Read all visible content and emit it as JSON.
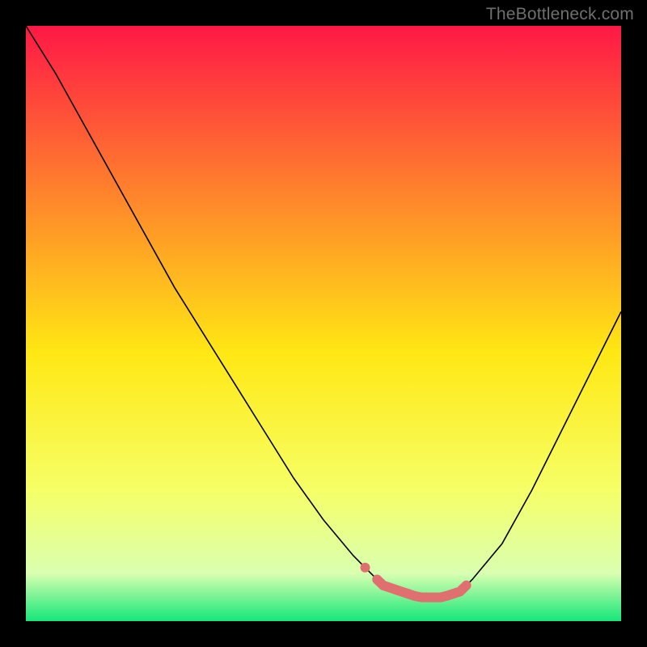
{
  "watermark": "TheBottleneck.com",
  "gradient": {
    "top": "#ff1846",
    "upper_mid": "#ff8a2a",
    "mid": "#ffe814",
    "lower_mid": "#f6ff67",
    "near_bottom": "#d9ffb0",
    "bottom": "#14e77a"
  },
  "curve": {
    "stroke": "#000000",
    "stroke_width": 1.6
  },
  "highlight": {
    "fill": "#e07070",
    "stroke": "#e07070"
  },
  "chart_data": {
    "type": "line",
    "title": "",
    "xlabel": "",
    "ylabel": "",
    "xlim": [
      0,
      100
    ],
    "ylim": [
      0,
      100
    ],
    "grid": false,
    "legend": false,
    "series": [
      {
        "name": "bottleneck-curve",
        "x": [
          0,
          5,
          10,
          15,
          20,
          25,
          30,
          35,
          40,
          45,
          50,
          55,
          57,
          60,
          63,
          66,
          70,
          73,
          75,
          80,
          85,
          90,
          95,
          100
        ],
        "y": [
          100,
          92,
          83,
          74,
          65,
          56,
          48,
          40,
          32,
          24,
          17,
          11,
          9,
          6,
          5,
          4,
          4,
          5,
          7,
          13,
          22,
          32,
          42,
          52
        ]
      }
    ],
    "annotations": [
      {
        "name": "optimal-region",
        "type": "marker-band",
        "x_start": 57,
        "x_end": 74,
        "y_approx": 5
      }
    ]
  }
}
